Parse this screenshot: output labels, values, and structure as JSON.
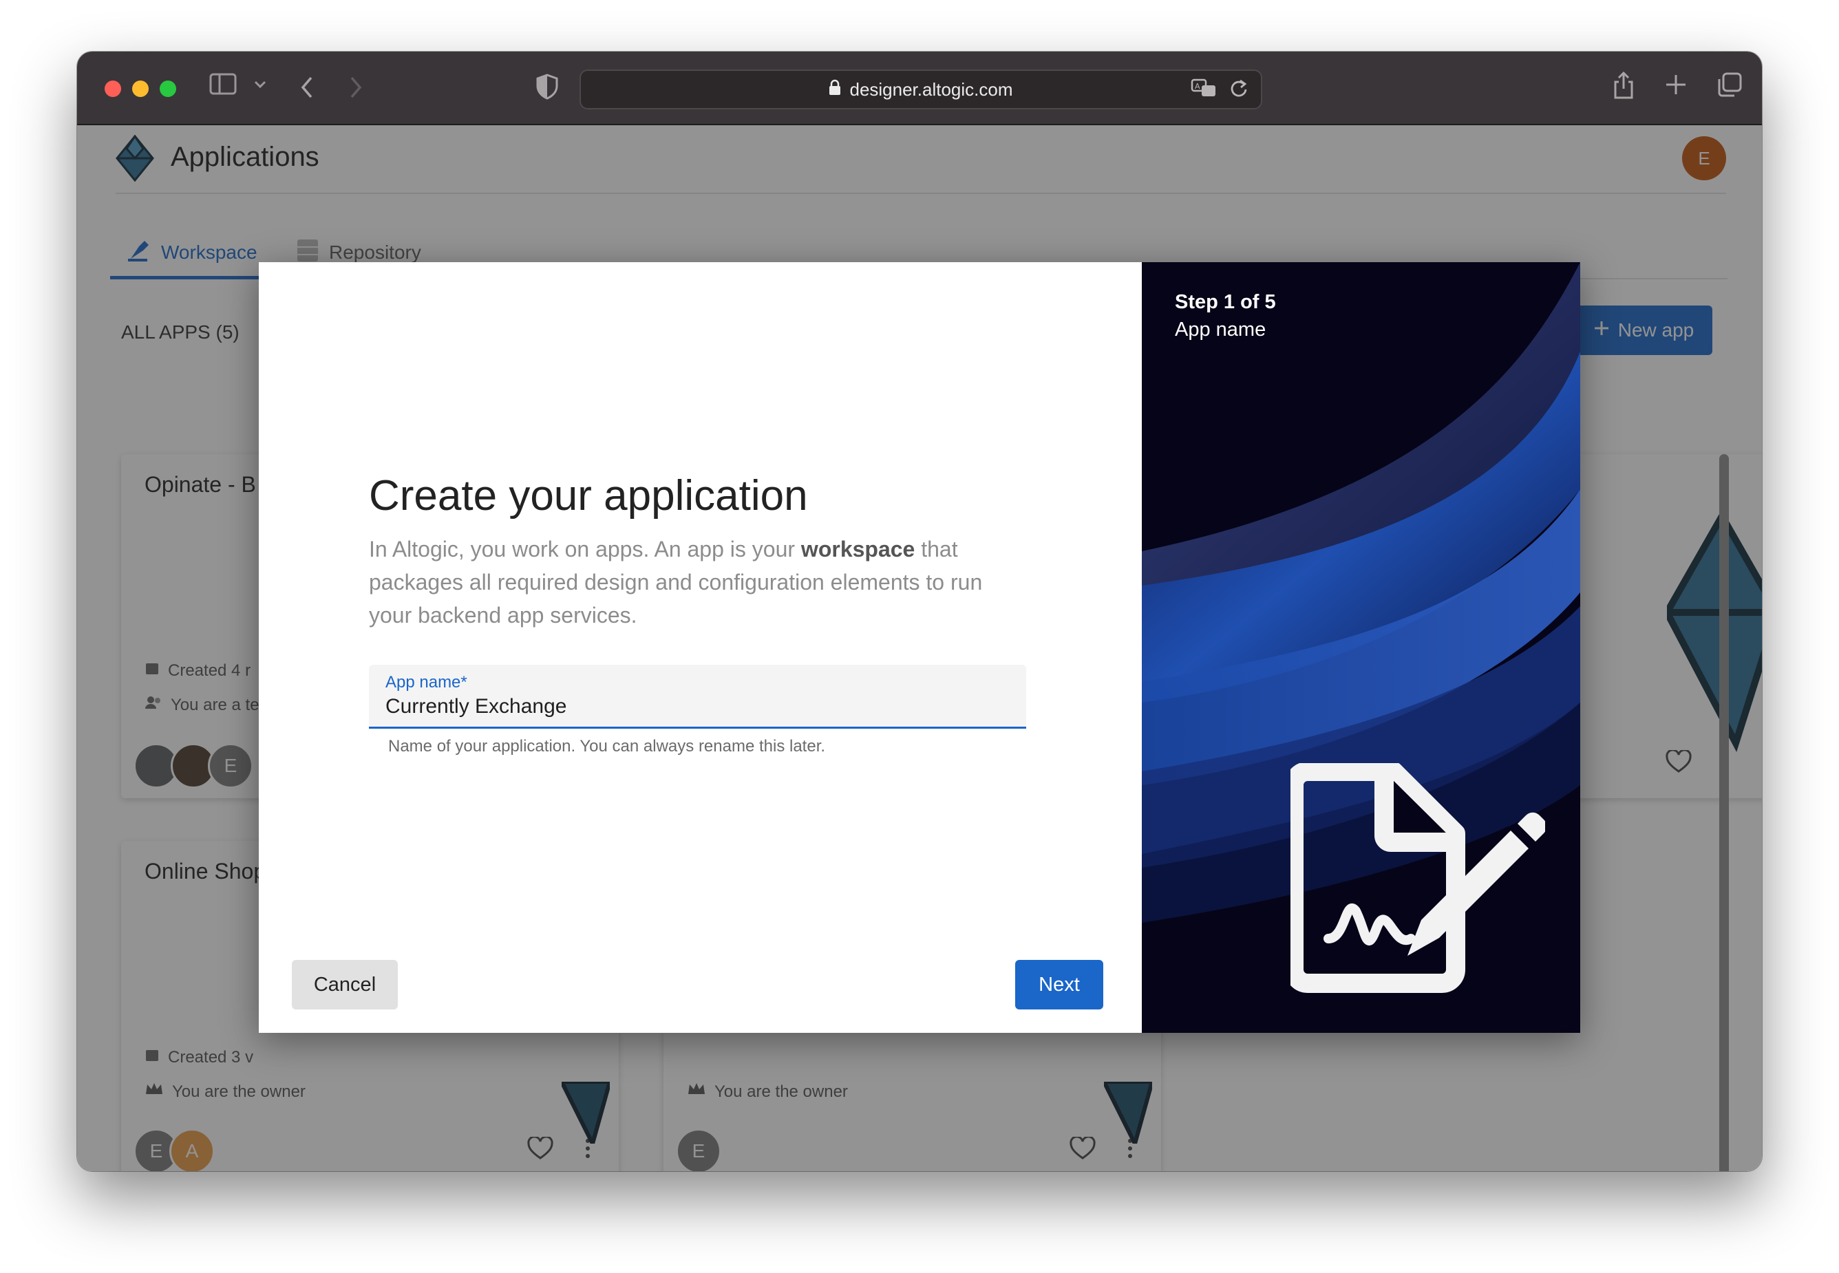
{
  "browser": {
    "url": "designer.altogic.com"
  },
  "app": {
    "title": "Applications",
    "user_initial": "E"
  },
  "tabs": [
    {
      "label": "Workspace",
      "active": true
    },
    {
      "label": "Repository",
      "active": false
    }
  ],
  "apps_list": {
    "count_label": "ALL APPS (5)",
    "new_app_label": "New app"
  },
  "cards": [
    {
      "title": "Opinate - B",
      "created": "Created 4 r",
      "role": "You are a te",
      "avatar_letter": "E"
    },
    {
      "title": "Online Shop",
      "created": "Created 3 v",
      "role": "You are the owner",
      "avatar_letters": [
        "E",
        "A"
      ]
    },
    {
      "role": "You are the owner",
      "avatar_letter": "E"
    }
  ],
  "modal": {
    "heading": "Create your application",
    "desc_before": "In Altogic, you work on apps. An app is your ",
    "desc_bold": "workspace",
    "desc_after": " that packages all required design and configuration elements to run your backend app services.",
    "field_label": "App name",
    "required_mark": "*",
    "field_value": "Currently Exchange",
    "field_help": "Name of your application. You can always rename this later.",
    "cancel_label": "Cancel",
    "next_label": "Next",
    "step_label": "Step 1 of 5",
    "step_name": "App name"
  },
  "colors": {
    "accent": "#1a66c9",
    "modal_panel_dark": "#060418",
    "avatar_orange": "#c2540f"
  }
}
